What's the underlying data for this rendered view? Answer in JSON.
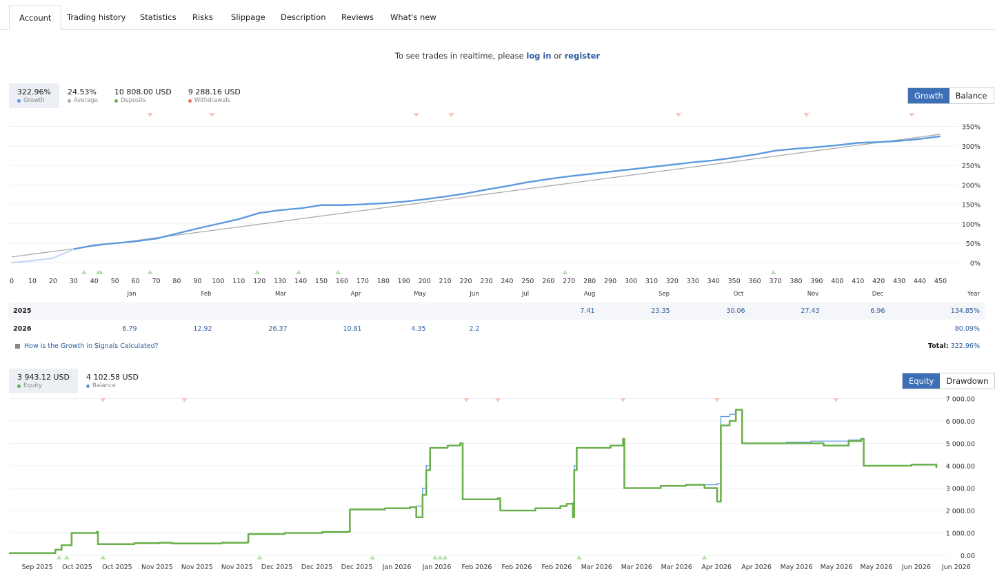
{
  "tabs": [
    "Account",
    "Trading history",
    "Statistics",
    "Risks",
    "Slippage",
    "Description",
    "Reviews",
    "What's new"
  ],
  "notice": {
    "prefix": "To see trades in realtime, please ",
    "login": "log in",
    "middle": " or ",
    "register": "register"
  },
  "growth_legend": [
    {
      "value": "322.96%",
      "label": "Growth",
      "color": "#5b9ae0"
    },
    {
      "value": "24.53%",
      "label": "Average",
      "color": "#aaaaaa"
    },
    {
      "value": "10 808.00 USD",
      "label": "Deposits",
      "color": "#6ab04c"
    },
    {
      "value": "9 288.16 USD",
      "label": "Withdrawals",
      "color": "#e8755a"
    }
  ],
  "growth_toggle": {
    "growth": "Growth",
    "balance": "Balance"
  },
  "equity_legend": [
    {
      "value": "3 943.12 USD",
      "label": "Equity",
      "color": "#6ab04c"
    },
    {
      "value": "4 102.58 USD",
      "label": "Balance",
      "color": "#5b9ae0"
    }
  ],
  "equity_toggle": {
    "equity": "Equity",
    "drawdown": "Drawdown"
  },
  "months": [
    "Jan",
    "Feb",
    "Mar",
    "Apr",
    "May",
    "Jun",
    "Jul",
    "Aug",
    "Sep",
    "Oct",
    "Nov",
    "Dec",
    "Year"
  ],
  "yearly": [
    {
      "year": "2025",
      "values": [
        "",
        "",
        "",
        "",
        "",
        "",
        "",
        "7.41",
        "23.35",
        "30.06",
        "27.43",
        "6.96"
      ],
      "total": "134.85%"
    },
    {
      "year": "2026",
      "values": [
        "6.79",
        "12.92",
        "26.37",
        "10.81",
        "4.35",
        "2.2",
        "",
        "",
        "",
        "",
        "",
        ""
      ],
      "total": "80.09%"
    }
  ],
  "help_link": "How is the Growth in Signals Calculated?",
  "total": {
    "label": "Total:",
    "value": "322.96%"
  },
  "chart_data": [
    {
      "type": "line",
      "x": [
        0,
        10,
        20,
        30,
        40,
        50,
        60,
        70,
        80,
        90,
        100,
        110,
        120,
        130,
        140,
        150,
        160,
        170,
        180,
        190,
        200,
        210,
        220,
        230,
        240,
        250,
        260,
        270,
        280,
        290,
        300,
        310,
        320,
        330,
        340,
        350,
        360,
        370,
        380,
        390,
        400,
        410,
        420,
        430,
        440,
        450
      ],
      "series": [
        {
          "name": "Growth",
          "color": "#5b9ae0",
          "values": [
            0,
            5,
            12,
            35,
            45,
            50,
            55,
            62,
            75,
            88,
            100,
            112,
            128,
            135,
            140,
            148,
            148,
            150,
            153,
            157,
            163,
            170,
            178,
            188,
            197,
            207,
            215,
            222,
            228,
            234,
            240,
            246,
            252,
            258,
            263,
            270,
            278,
            288,
            293,
            297,
            302,
            308,
            310,
            313,
            318,
            325
          ]
        },
        {
          "name": "Average",
          "color": "#aaaaaa",
          "values": [
            15,
            22,
            29,
            36,
            43,
            50,
            57,
            64,
            71,
            78,
            85,
            92,
            99,
            106,
            113,
            120,
            127,
            134,
            141,
            148,
            155,
            162,
            169,
            176,
            183,
            190,
            197,
            204,
            211,
            218,
            225,
            232,
            239,
            246,
            253,
            260,
            267,
            274,
            281,
            288,
            295,
            302,
            309,
            316,
            323,
            330
          ]
        }
      ],
      "yticks": [
        "0%",
        "50%",
        "100%",
        "150%",
        "200%",
        "250%",
        "300%",
        "350%"
      ],
      "xticks": [
        "0",
        "10",
        "20",
        "30",
        "40",
        "50",
        "60",
        "70",
        "80",
        "90",
        "100",
        "110",
        "120",
        "130",
        "140",
        "150",
        "160",
        "170",
        "180",
        "190",
        "200",
        "210",
        "220",
        "230",
        "240",
        "250",
        "260",
        "270",
        "280",
        "290",
        "300",
        "310",
        "320",
        "330",
        "340",
        "350",
        "360",
        "370",
        "380",
        "390",
        "400",
        "410",
        "420",
        "430",
        "440",
        "450"
      ],
      "ylim": [
        -10,
        360
      ],
      "xlim": [
        0,
        453
      ],
      "deposits_x": [
        35,
        42,
        43,
        67,
        119,
        139,
        158,
        268,
        369
      ],
      "withdrawals_x": [
        67,
        97,
        196,
        213,
        323,
        385,
        436
      ]
    },
    {
      "type": "line",
      "series": [
        {
          "name": "Equity",
          "color": "#6ab04c"
        },
        {
          "name": "Balance",
          "color": "#5b9ae0"
        }
      ],
      "points": [
        [
          0,
          100
        ],
        [
          3,
          100
        ],
        [
          3.7,
          250
        ],
        [
          4.2,
          450
        ],
        [
          5,
          1000
        ],
        [
          7,
          1050
        ],
        [
          7.1,
          500
        ],
        [
          10,
          540
        ],
        [
          12,
          560
        ],
        [
          13,
          530
        ],
        [
          17,
          560
        ],
        [
          19,
          580
        ],
        [
          19.1,
          950
        ],
        [
          22,
          1000
        ],
        [
          25,
          1040
        ],
        [
          27,
          1050
        ],
        [
          27.2,
          2050
        ],
        [
          30,
          2100
        ],
        [
          32,
          2150
        ],
        [
          32.5,
          1700
        ],
        [
          33,
          2700
        ],
        [
          33.3,
          3800
        ],
        [
          33.6,
          4800
        ],
        [
          35,
          4900
        ],
        [
          36,
          5000
        ],
        [
          36.2,
          2500
        ],
        [
          39,
          2550
        ],
        [
          39.2,
          2000
        ],
        [
          42,
          2100
        ],
        [
          44,
          2200
        ],
        [
          44.5,
          2300
        ],
        [
          45,
          1700
        ],
        [
          45.1,
          3800
        ],
        [
          45.3,
          4800
        ],
        [
          48,
          4900
        ],
        [
          49,
          5200
        ],
        [
          49.1,
          3000
        ],
        [
          52,
          3100
        ],
        [
          54,
          3150
        ],
        [
          55.5,
          3000
        ],
        [
          56.5,
          2400
        ],
        [
          56.8,
          5800
        ],
        [
          57.5,
          6000
        ],
        [
          58,
          6500
        ],
        [
          58.5,
          5000
        ],
        [
          62,
          5000
        ],
        [
          64,
          5000
        ],
        [
          65,
          4900
        ],
        [
          67,
          5100
        ],
        [
          68,
          5200
        ],
        [
          68.2,
          4000
        ],
        [
          72,
          4050
        ],
        [
          73,
          4050
        ],
        [
          74,
          3900
        ]
      ],
      "balance_points": [
        [
          0,
          100
        ],
        [
          3,
          100
        ],
        [
          3.7,
          250
        ],
        [
          4.2,
          450
        ],
        [
          5,
          1000
        ],
        [
          7,
          1050
        ],
        [
          7.1,
          500
        ],
        [
          10,
          540
        ],
        [
          12,
          560
        ],
        [
          13,
          530
        ],
        [
          17,
          560
        ],
        [
          19,
          580
        ],
        [
          19.1,
          950
        ],
        [
          22,
          1000
        ],
        [
          25,
          1040
        ],
        [
          27,
          1050
        ],
        [
          27.2,
          2050
        ],
        [
          30,
          2100
        ],
        [
          32,
          2150
        ],
        [
          32.5,
          2200
        ],
        [
          33,
          3000
        ],
        [
          33.3,
          4000
        ],
        [
          33.6,
          4800
        ],
        [
          35,
          4900
        ],
        [
          36,
          5000
        ],
        [
          36.2,
          2500
        ],
        [
          39,
          2550
        ],
        [
          39.2,
          2000
        ],
        [
          42,
          2100
        ],
        [
          44,
          2200
        ],
        [
          44.5,
          2300
        ],
        [
          45,
          2350
        ],
        [
          45.1,
          4000
        ],
        [
          45.3,
          4800
        ],
        [
          48,
          4900
        ],
        [
          49,
          5100
        ],
        [
          49.1,
          3000
        ],
        [
          52,
          3100
        ],
        [
          54,
          3150
        ],
        [
          56.5,
          3200
        ],
        [
          56.8,
          6200
        ],
        [
          57.5,
          6300
        ],
        [
          58,
          6500
        ],
        [
          58.5,
          5000
        ],
        [
          62,
          5050
        ],
        [
          64,
          5100
        ],
        [
          67,
          5150
        ],
        [
          68,
          5200
        ],
        [
          68.2,
          4000
        ],
        [
          72,
          4050
        ],
        [
          74,
          4100
        ]
      ],
      "yticks": [
        "0.00",
        "1 000.00",
        "2 000.00",
        "3 000.00",
        "4 000.00",
        "5 000.00",
        "6 000.00",
        "7 000.00"
      ],
      "xticks": [
        "Sep 2025",
        "Oct 2025",
        "Oct 2025",
        "Nov 2025",
        "Nov 2025",
        "Nov 2025",
        "Dec 2025",
        "Dec 2025",
        "Dec 2025",
        "Jan 2026",
        "Jan 2026",
        "Feb 2026",
        "Feb 2026",
        "Feb 2026",
        "Mar 2026",
        "Mar 2026",
        "Mar 2026",
        "Apr 2026",
        "Apr 2026",
        "May 2026",
        "May 2026",
        "May 2026",
        "Jun 2026",
        "Jun 2026"
      ],
      "ylim": [
        -400,
        7200
      ],
      "xlim": [
        0,
        74
      ],
      "deposits_x": [
        4,
        4.6,
        7.5,
        20,
        29,
        34,
        34.4,
        34.8,
        45.5,
        55.5
      ],
      "withdrawals_x": [
        7.5,
        14,
        36.5,
        39,
        49,
        56.5,
        66
      ]
    }
  ]
}
